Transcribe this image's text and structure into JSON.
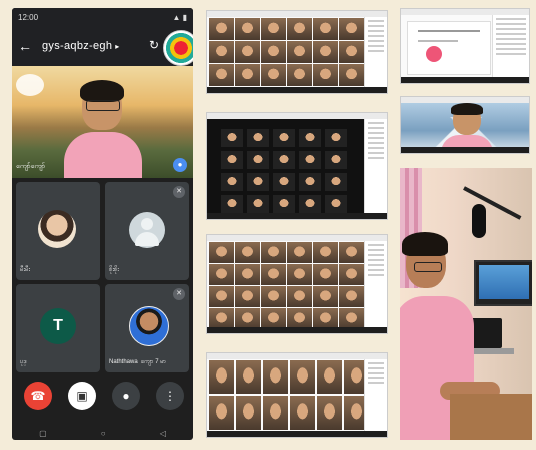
{
  "phone": {
    "status_left": "12:00",
    "status_right": "▲ ▮",
    "back_icon": "arrow-left-icon",
    "meeting_code": "gys-aqbz-egh",
    "main_speaker_name": "ကျော်ကျော်",
    "participants": [
      {
        "name": "မီးမီး",
        "type": "photo",
        "muted": true
      },
      {
        "name": "စိုးစိုး",
        "type": "default-avatar",
        "muted": true
      },
      {
        "name": "ပုဒ္",
        "type": "letter",
        "letter": "T",
        "color": "#0d5a48",
        "muted": false
      },
      {
        "name": "Naththawa",
        "extra": "ကျော 7 မာ",
        "type": "photo",
        "muted": true
      }
    ],
    "controls": [
      {
        "name": "end-call-icon",
        "glyph": "☎",
        "color": "#ea4335"
      },
      {
        "name": "camera-off-icon",
        "glyph": "▣",
        "color": "#ffffff"
      },
      {
        "name": "microphone-icon",
        "glyph": "‡",
        "color": "#3c4043"
      },
      {
        "name": "more-options-icon",
        "glyph": "⋮",
        "color": "#3c4043"
      }
    ],
    "nav": [
      "▢",
      "○",
      "◁"
    ]
  },
  "colors": {
    "background": "#f4ecd9",
    "meet_dark": "#202124",
    "tile": "#3c4043",
    "accent_blue": "#4b8ef1",
    "end_call": "#ea4335"
  }
}
